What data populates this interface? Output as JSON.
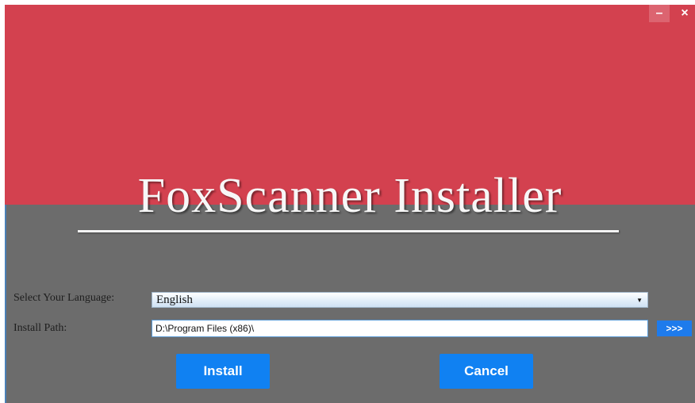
{
  "window": {
    "minimize_label": "–",
    "close_label": "×",
    "accent_color": "#d3414f",
    "body_color": "#6c6c6c"
  },
  "hero": {
    "title": "FoxScanner Installer"
  },
  "form": {
    "language_label": "Select Your Language:",
    "language_value": "English",
    "language_arrow": "▼",
    "path_label": "Install Path:",
    "path_value": "D:\\Program Files (x86)\\",
    "browse_label": ">>>"
  },
  "actions": {
    "install_label": "Install",
    "cancel_label": "Cancel",
    "button_color": "#1081f2"
  },
  "icons": [
    "minimize-icon",
    "close-icon",
    "dropdown-arrow-icon"
  ]
}
